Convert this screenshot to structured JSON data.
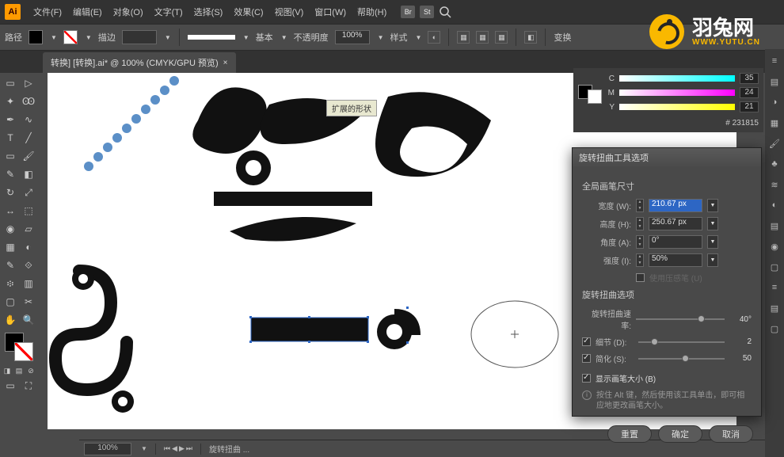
{
  "app": {
    "logo_text": "Ai"
  },
  "menu": {
    "file": "文件(F)",
    "edit": "编辑(E)",
    "object": "对象(O)",
    "type": "文字(T)",
    "select": "选择(S)",
    "effect": "效果(C)",
    "view": "视图(V)",
    "window": "窗口(W)",
    "help": "帮助(H)"
  },
  "title_badges": [
    "Br",
    "St"
  ],
  "controlbar": {
    "label": "路径",
    "strokeLabel": "描边",
    "strokeValue": "",
    "styleLabel": "基本",
    "opacityLabel": "不透明度",
    "opacityValue": "100%",
    "styleBtn": "样式",
    "transform": "变换"
  },
  "tab": {
    "name": "转换] [转换].ai* @ 100% (CMYK/GPU 预览)"
  },
  "tooltip": {
    "text": "扩展的形状"
  },
  "color_panel": {
    "c": "35",
    "m": "24",
    "y": "21",
    "hex": "231815"
  },
  "dialog": {
    "title": "旋转扭曲工具选项",
    "section1": "全局画笔尺寸",
    "width_label": "宽度 (W):",
    "width_value": "210.67 px",
    "height_label": "高度 (H):",
    "height_value": "250.67 px",
    "angle_label": "角度 (A):",
    "angle_value": "0°",
    "intensity_label": "强度 (I):",
    "intensity_value": "50%",
    "pressure_label": "使用压感笔 (U)",
    "section2": "旋转扭曲选项",
    "rate_label": "旋转扭曲速率:",
    "rate_value": "40°",
    "detail_label": "细节 (D):",
    "detail_value": "2",
    "simplify_label": "简化 (S):",
    "simplify_value": "50",
    "show_brush": "显示画笔大小 (B)",
    "info": "按住 Alt 键，然后使用该工具单击，即可相应地更改画笔大小。",
    "reset": "重置",
    "ok": "确定",
    "cancel": "取消"
  },
  "status": {
    "zoom": "100%",
    "tool_label": "旋转扭曲 ..."
  },
  "watermark": {
    "main": "羽兔网",
    "sub": "WWW.YUTU.CN"
  }
}
